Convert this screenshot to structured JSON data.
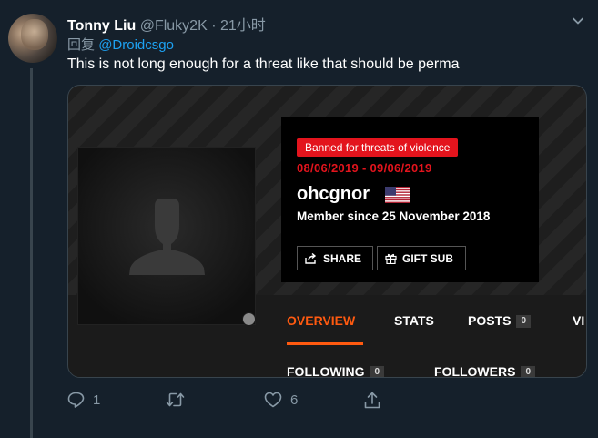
{
  "tweet": {
    "author_name": "Tonny Liu",
    "handle": "@Fluky2K",
    "separator": "·",
    "time": "21小时",
    "reply_prefix": "回复",
    "reply_to": "@Droidcsgo",
    "text": "This is not long enough for a threat like that should be perma"
  },
  "card": {
    "ban_badge": "Banned for threats of violence",
    "ban_dates": "08/06/2019 - 09/06/2019",
    "username": "ohcgnor",
    "member_since": "Member since 25 November 2018",
    "share_label": "SHARE",
    "gift_label": "GIFT SUB",
    "tabs": [
      {
        "label": "OVERVIEW"
      },
      {
        "label": "STATS"
      },
      {
        "label": "POSTS",
        "count": "0"
      },
      {
        "label": "VI"
      }
    ],
    "following_label": "FOLLOWING",
    "following_count": "0",
    "followers_label": "FOLLOWERS",
    "followers_count": "0"
  },
  "actions": {
    "replies": "1",
    "retweets": "",
    "likes": "6"
  },
  "colors": {
    "background": "#15202b",
    "muted": "#8899a6",
    "link": "#1da1f2",
    "ban_red": "#e3141d",
    "accent_orange": "#ff5a10"
  },
  "icons": [
    "chevron-down-icon",
    "share-icon",
    "gift-icon",
    "reply-icon",
    "retweet-icon",
    "like-icon",
    "upload-icon",
    "us-flag-icon",
    "default-avatar-icon"
  ]
}
